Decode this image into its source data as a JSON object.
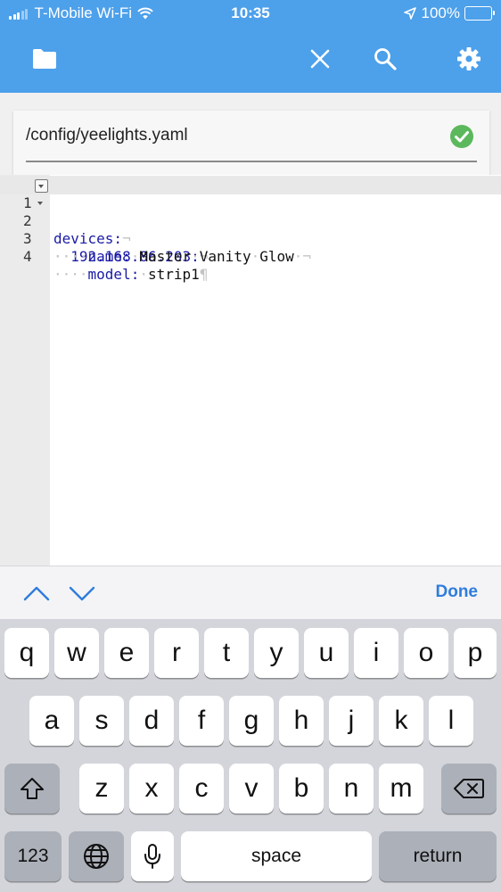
{
  "status_bar": {
    "carrier": "T-Mobile Wi-Fi",
    "time": "10:35",
    "battery": "100%"
  },
  "toolbar": {
    "icons": [
      "folder-icon",
      "close-icon",
      "search-icon",
      "settings-icon"
    ]
  },
  "file": {
    "path": "/config/yeelights.yaml",
    "status_icon": "check-circle-icon"
  },
  "editor": {
    "lines": [
      {
        "number": "1",
        "key": "devices:",
        "value": "",
        "end": "¬"
      },
      {
        "number": "2",
        "key": "192.168.86.203:",
        "value": "",
        "end": "¬"
      },
      {
        "number": "3",
        "key": "name:",
        "value": "Master Vanity Glow",
        "end": "¬"
      },
      {
        "number": "4",
        "key": "model:",
        "value": "strip1",
        "end": "¶"
      }
    ]
  },
  "accessory": {
    "done_label": "Done"
  },
  "keyboard": {
    "row1": [
      "q",
      "w",
      "e",
      "r",
      "t",
      "y",
      "u",
      "i",
      "o",
      "p"
    ],
    "row2": [
      "a",
      "s",
      "d",
      "f",
      "g",
      "h",
      "j",
      "k",
      "l"
    ],
    "row3": [
      "z",
      "x",
      "c",
      "v",
      "b",
      "n",
      "m"
    ],
    "numbers_label": "123",
    "space_label": "space",
    "return_label": "return"
  },
  "colors": {
    "app_bar": "#4da0ea",
    "yaml_key": "#1a1aa6",
    "valid_check": "#5cb85c",
    "done": "#2f7cdc"
  }
}
